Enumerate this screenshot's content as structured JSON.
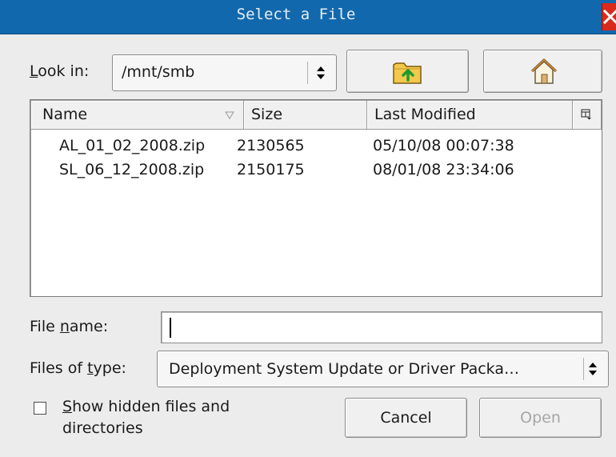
{
  "window": {
    "title": "Select a File"
  },
  "look_in": {
    "label_prefix": "",
    "label_mnemonic": "L",
    "label_rest": "ook in:",
    "value": "/mnt/smb"
  },
  "toolbar": {
    "up_folder_icon": "folder-up-icon",
    "home_icon": "home-icon"
  },
  "file_list": {
    "columns": [
      {
        "label": "Name"
      },
      {
        "label": "Size"
      },
      {
        "label": "Last Modified"
      }
    ],
    "rows": [
      {
        "name": "AL_01_02_2008.zip",
        "size": "2130565",
        "modified": "05/10/08 00:07:38"
      },
      {
        "name": "SL_06_12_2008.zip",
        "size": "2150175",
        "modified": "08/01/08 23:34:06"
      }
    ]
  },
  "file_name": {
    "label_prefix": "File ",
    "label_mnemonic": "n",
    "label_rest": "ame:",
    "value": ""
  },
  "file_type": {
    "label_prefix": "Files of ",
    "label_mnemonic": "t",
    "label_rest": "ype:",
    "value": "Deployment System Update or Driver Packa…"
  },
  "show_hidden": {
    "label_mnemonic": "S",
    "label_rest": "how hidden files and directories",
    "checked": false
  },
  "buttons": {
    "cancel": "Cancel",
    "open": "Open"
  },
  "colors": {
    "titlebar": "#1268ad",
    "close": "#d92a1c",
    "folder": "#f2c94c"
  }
}
